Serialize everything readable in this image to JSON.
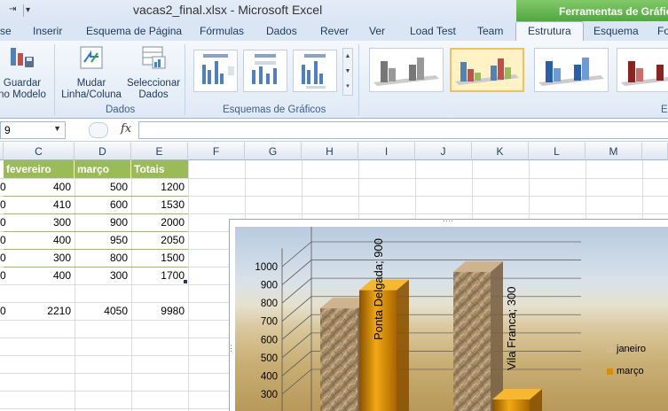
{
  "window": {
    "title": "vacas2_final.xlsx  -  Microsoft Excel",
    "context_title": "Ferramentas de Gráfico"
  },
  "qat": {
    "redo": "⇥",
    "customize": "▾"
  },
  "tabs": [
    {
      "label": "se"
    },
    {
      "label": "Inserir"
    },
    {
      "label": "Esquema de Página"
    },
    {
      "label": "Fórmulas"
    },
    {
      "label": "Dados"
    },
    {
      "label": "Rever"
    },
    {
      "label": "Ver"
    },
    {
      "label": "Load Test"
    },
    {
      "label": "Team"
    },
    {
      "label": "Estrutura"
    },
    {
      "label": "Esquema"
    },
    {
      "label": "Fo"
    }
  ],
  "ribbon": {
    "save_template": "Guardar\nno Modelo",
    "switch_row_col": "Mudar\nLinha/Coluna",
    "select_data": "Seleccionar\nDados",
    "group_data": "Dados",
    "group_layouts": "Esquemas de Gráficos",
    "group_styles": "E"
  },
  "formula_bar": {
    "name_box": "9",
    "fx": "fx",
    "value": ""
  },
  "columns": [
    "C",
    "D",
    "E",
    "F",
    "G",
    "H",
    "I",
    "J",
    "K",
    "L",
    "M"
  ],
  "table": {
    "headers": [
      "fevereiro",
      "março",
      "Totais"
    ],
    "rows": [
      [
        "400",
        "500",
        "1200"
      ],
      [
        "410",
        "600",
        "1530"
      ],
      [
        "300",
        "900",
        "2000"
      ],
      [
        "400",
        "950",
        "2050"
      ],
      [
        "300",
        "800",
        "1500"
      ],
      [
        "400",
        "300",
        "1700"
      ]
    ],
    "totals": [
      "2210",
      "4050",
      "9980"
    ],
    "left_fragment": "0"
  },
  "chart_data": {
    "type": "bar",
    "categories": [
      "Ponta Delgada",
      "Vila Franca"
    ],
    "series": [
      {
        "name": "janeiro",
        "values": [
          800,
          1000
        ]
      },
      {
        "name": "março",
        "values": [
          900,
          300
        ]
      }
    ],
    "y_ticks": [
      "300",
      "400",
      "500",
      "600",
      "700",
      "800",
      "900",
      "1000"
    ],
    "data_labels": [
      "Ponta Delgada; 900",
      "Vila Franca; 300"
    ],
    "ylim": [
      300,
      1100
    ],
    "legend_position": "right",
    "colors": {
      "janeiro": "#a48a5f",
      "março": "#d98c00"
    }
  }
}
